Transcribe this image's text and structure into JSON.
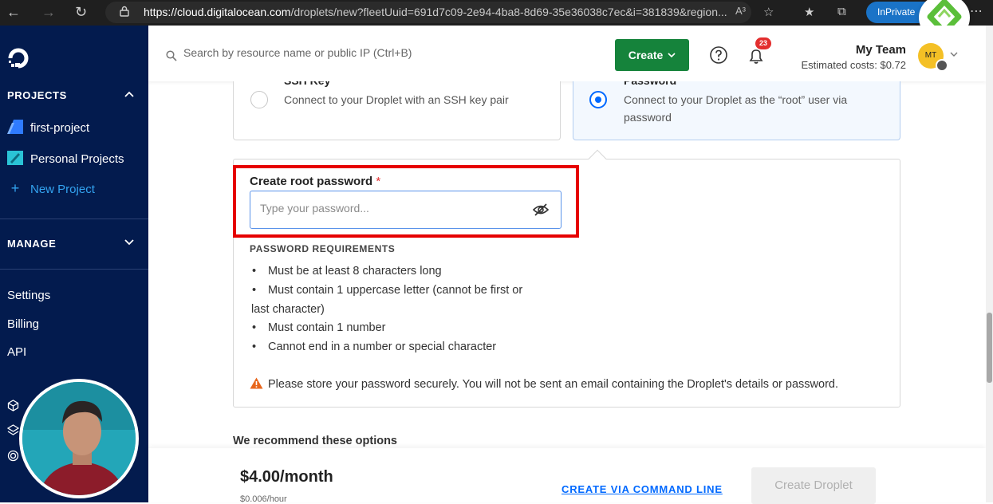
{
  "browser": {
    "url_host": "https://cloud.digitalocean.com",
    "url_path": "/droplets/new?fleetUuid=691d7c09-2e94-4ba8-8d69-35e36038c7ec&i=381839&region...",
    "inprivate_label": "InPrivate",
    "read_aloud": "A³"
  },
  "sidebar": {
    "projects_heading": "PROJECTS",
    "projects": [
      {
        "label": "first-project",
        "color": "#2f7bff"
      },
      {
        "label": "Personal Projects",
        "color": "#2ac3d6"
      }
    ],
    "new_project_label": "New Project",
    "manage_heading": "MANAGE",
    "links": [
      "Settings",
      "Billing",
      "API"
    ]
  },
  "header": {
    "search_placeholder": "Search by resource name or public IP (Ctrl+B)",
    "create_label": "Create",
    "notification_count": "23",
    "team_name": "My Team",
    "estimated_costs": "Estimated costs: $0.72",
    "avatar_initials": "MT"
  },
  "auth": {
    "ssh": {
      "title": "SSH Key",
      "description": "Connect to your Droplet with an SSH key pair"
    },
    "password": {
      "title": "Password",
      "description_line1": "Connect to your Droplet as the “root” user via",
      "description_line2": "password"
    }
  },
  "password_form": {
    "label": "Create root password",
    "required_mark": "*",
    "placeholder": "Type your password...",
    "requirements_heading": "PASSWORD REQUIREMENTS",
    "requirements": [
      "Must be at least 8 characters long",
      "Must contain 1 uppercase letter (cannot be first or",
      "last character)",
      "Must contain 1 number",
      "Cannot end in a number or special character"
    ],
    "warning": "Please store your password securely. You will not be sent an email containing the Droplet's details or password."
  },
  "recommend_heading": "We recommend these options",
  "footer": {
    "price": "$4.00/month",
    "price_hourly": "$0.006/hour",
    "cli_link": "CREATE VIA COMMAND LINE",
    "create_droplet": "Create Droplet"
  },
  "colors": {
    "sidebar_bg": "#031b4e",
    "create_button": "#15833b",
    "accent_blue": "#0069ff",
    "highlight_red": "#e60000"
  }
}
